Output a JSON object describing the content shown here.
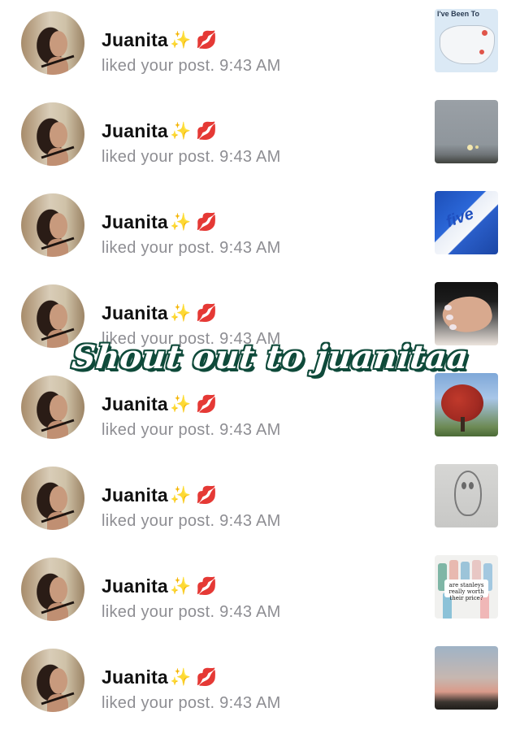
{
  "notifications": [
    {
      "name": "Juanita",
      "emoji": "✨ 💋",
      "text": "liked your post. 9:43 AM",
      "thumb_caption": "I've Been To"
    },
    {
      "name": "Juanita",
      "emoji": "✨ 💋",
      "text": "liked your post. 9:43 AM"
    },
    {
      "name": "Juanita",
      "emoji": "✨ 💋",
      "text": "liked your post. 9:43 AM",
      "thumb_caption": "five"
    },
    {
      "name": "Juanita",
      "emoji": "✨ 💋",
      "text": "liked your post. 9:43 AM"
    },
    {
      "name": "Juanita",
      "emoji": "✨ 💋",
      "text": "liked your post. 9:43 AM"
    },
    {
      "name": "Juanita",
      "emoji": "✨ 💋",
      "text": "liked your post. 9:43 AM"
    },
    {
      "name": "Juanita",
      "emoji": "✨ 💋",
      "text": "liked your post. 9:43 AM",
      "thumb_caption": "are stanleys really worth their price?"
    },
    {
      "name": "Juanita",
      "emoji": "✨ 💋",
      "text": "liked your post. 9:43 AM"
    }
  ],
  "overlay_text": "Shout out to juanitaa",
  "colors": {
    "overlay_outline": "#0f4a3a",
    "secondary_text": "#8e8e93"
  }
}
